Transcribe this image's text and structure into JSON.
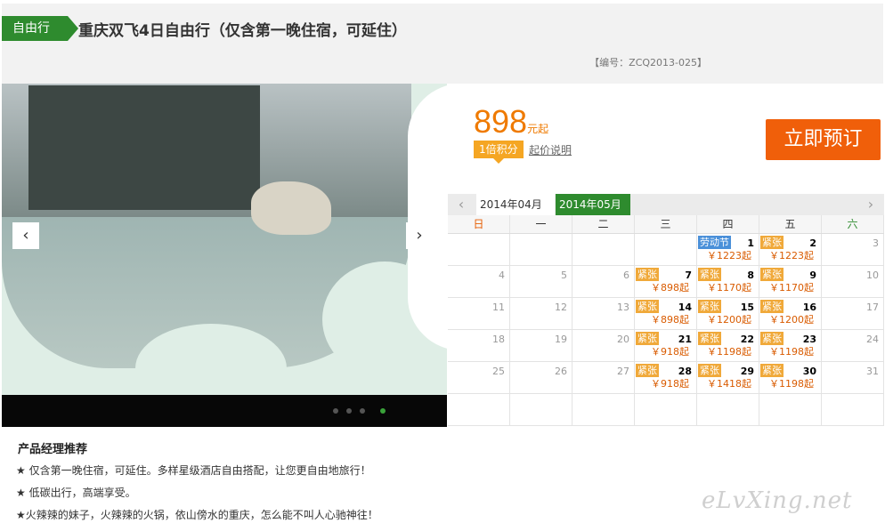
{
  "header": {
    "tag": "自由行",
    "title": "重庆双飞4日自由行（仅含第一晚住宿，可延住）",
    "code": "【编号：ZCQ2013-025】"
  },
  "gallery": {
    "prev_icon": "‹",
    "next_icon": "›",
    "dots": 4,
    "active_dot": 3
  },
  "price": {
    "amount": "898",
    "unit": "元起",
    "points_label": "1倍积分",
    "explain_label": "起价说明"
  },
  "book_button": "立即预订",
  "calendar": {
    "prev_icon": "‹",
    "next_icon": "›",
    "month_prev": "2014年04月",
    "month_current": "2014年05月",
    "weekdays": [
      "日",
      "一",
      "二",
      "三",
      "四",
      "五",
      "六"
    ],
    "weeks": [
      [
        {
          "day": "",
          "badge": "",
          "price": ""
        },
        {
          "day": "",
          "badge": "",
          "price": ""
        },
        {
          "day": "",
          "badge": "",
          "price": ""
        },
        {
          "day": "",
          "badge": "",
          "price": ""
        },
        {
          "day": "1",
          "badge": "劳动节",
          "price": "￥1223起",
          "holiday": true
        },
        {
          "day": "2",
          "badge": "紧张",
          "price": "￥1223起"
        },
        {
          "day": "3",
          "badge": "",
          "price": ""
        }
      ],
      [
        {
          "day": "4",
          "badge": "",
          "price": ""
        },
        {
          "day": "5",
          "badge": "",
          "price": ""
        },
        {
          "day": "6",
          "badge": "",
          "price": ""
        },
        {
          "day": "7",
          "badge": "紧张",
          "price": "￥898起"
        },
        {
          "day": "8",
          "badge": "紧张",
          "price": "￥1170起"
        },
        {
          "day": "9",
          "badge": "紧张",
          "price": "￥1170起"
        },
        {
          "day": "10",
          "badge": "",
          "price": ""
        }
      ],
      [
        {
          "day": "11",
          "badge": "",
          "price": ""
        },
        {
          "day": "12",
          "badge": "",
          "price": ""
        },
        {
          "day": "13",
          "badge": "",
          "price": ""
        },
        {
          "day": "14",
          "badge": "紧张",
          "price": "￥898起"
        },
        {
          "day": "15",
          "badge": "紧张",
          "price": "￥1200起"
        },
        {
          "day": "16",
          "badge": "紧张",
          "price": "￥1200起"
        },
        {
          "day": "17",
          "badge": "",
          "price": ""
        }
      ],
      [
        {
          "day": "18",
          "badge": "",
          "price": ""
        },
        {
          "day": "19",
          "badge": "",
          "price": ""
        },
        {
          "day": "20",
          "badge": "",
          "price": ""
        },
        {
          "day": "21",
          "badge": "紧张",
          "price": "￥918起"
        },
        {
          "day": "22",
          "badge": "紧张",
          "price": "￥1198起"
        },
        {
          "day": "23",
          "badge": "紧张",
          "price": "￥1198起"
        },
        {
          "day": "24",
          "badge": "",
          "price": ""
        }
      ],
      [
        {
          "day": "25",
          "badge": "",
          "price": ""
        },
        {
          "day": "26",
          "badge": "",
          "price": ""
        },
        {
          "day": "27",
          "badge": "",
          "price": ""
        },
        {
          "day": "28",
          "badge": "紧张",
          "price": "￥918起"
        },
        {
          "day": "29",
          "badge": "紧张",
          "price": "￥1418起"
        },
        {
          "day": "30",
          "badge": "紧张",
          "price": "￥1198起"
        },
        {
          "day": "31",
          "badge": "",
          "price": ""
        }
      ],
      [
        {
          "day": "",
          "badge": "",
          "price": ""
        },
        {
          "day": "",
          "badge": "",
          "price": ""
        },
        {
          "day": "",
          "badge": "",
          "price": ""
        },
        {
          "day": "",
          "badge": "",
          "price": ""
        },
        {
          "day": "",
          "badge": "",
          "price": ""
        },
        {
          "day": "",
          "badge": "",
          "price": ""
        },
        {
          "day": "",
          "badge": "",
          "price": ""
        }
      ]
    ]
  },
  "recommend": {
    "title": "产品经理推荐",
    "lines": [
      "★ 仅含第一晚住宿，可延住。多样星级酒店自由搭配，让您更自由地旅行！",
      "★ 低碳出行，高端享受。",
      "★火辣辣的妹子，火辣辣的火锅，依山傍水的重庆，怎么能不叫人心驰神往！"
    ]
  },
  "watermark": "eLvXing.net",
  "colors": {
    "green": "#2e8b2e",
    "orange": "#f05f0a",
    "price": "#ef7a00",
    "badge": "#f0a93a"
  }
}
